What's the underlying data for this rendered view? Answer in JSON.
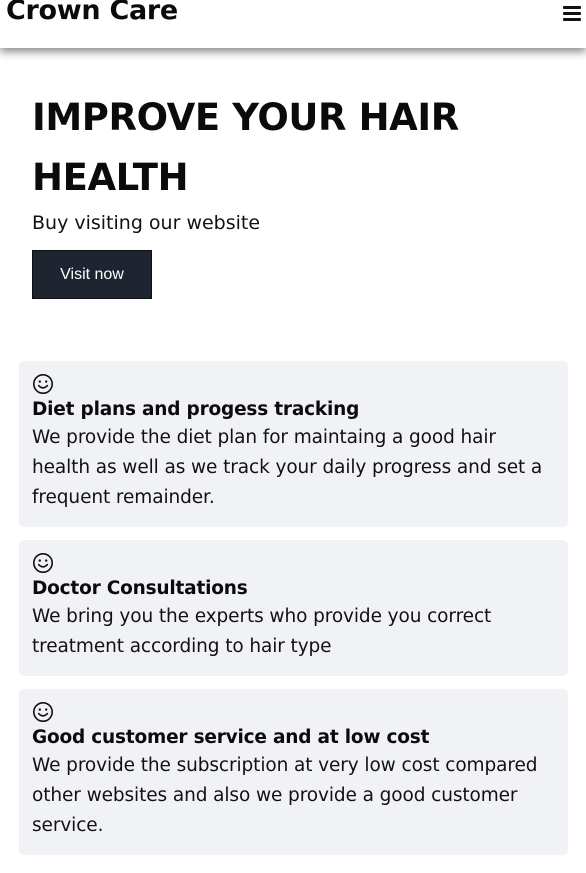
{
  "navbar": {
    "brand": "Crown Care",
    "menu_icon": "hamburger-menu-icon"
  },
  "hero": {
    "title": "IMPROVE YOUR HAIR HEALTH",
    "subtitle": "Buy visiting our website",
    "button_label": "Visit now"
  },
  "features": [
    {
      "icon": "smiley-face-icon",
      "title": "Diet plans and progess tracking",
      "text": "We provide the diet plan for maintaing a good hair health as well as we track your daily progress and set a frequent remainder."
    },
    {
      "icon": "smiley-face-icon",
      "title": "Doctor Consultations",
      "text": "We bring you the experts who provide you correct treatment according to hair type"
    },
    {
      "icon": "smiley-face-icon",
      "title": "Good customer service and at low cost",
      "text": "We provide the subscription at very low cost compared other websites and also we provide a good customer service."
    }
  ],
  "colors": {
    "button_bg": "#1f2530",
    "card_bg": "#f1f2f6",
    "text": "#111111"
  }
}
